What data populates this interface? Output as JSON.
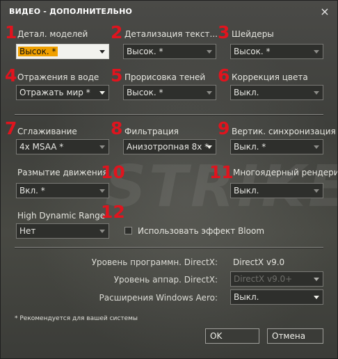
{
  "window": {
    "title": "ВИДЕО - ДОПОЛНИТЕЛЬНО"
  },
  "icons": {
    "close": "×"
  },
  "settings": [
    {
      "number": "1",
      "label": "Детал. моделей",
      "value": "Высок. *"
    },
    {
      "number": "2",
      "label": "Детализация текст...",
      "value": "Высок. *"
    },
    {
      "number": "3",
      "label": "Шейдеры",
      "value": "Высок. *"
    },
    {
      "number": "4",
      "label": "Отражения в воде",
      "value": "Отражать мир *"
    },
    {
      "number": "5",
      "label": "Прорисовка теней",
      "value": "Высок. *"
    },
    {
      "number": "6",
      "label": "Коррекция цвета",
      "value": "Выкл."
    },
    {
      "number": "7",
      "label": "Сглаживание",
      "value": "4x MSAA *"
    },
    {
      "number": "8",
      "label": "Фильтрация",
      "value": "Анизотропная 8x *"
    },
    {
      "number": "9",
      "label": "Вертик. синхронизация",
      "value": "Выкл. *"
    },
    {
      "number": "10",
      "label": "Размытие движения",
      "value": "Вкл. *"
    },
    {
      "number": "11",
      "label": "Многоядерный рендеринг",
      "value": "Выкл."
    },
    {
      "number": "12",
      "label": "High Dynamic Range",
      "value": "Нет"
    }
  ],
  "bloom": {
    "label": "Использовать эффект Bloom",
    "checked": false
  },
  "directx": {
    "software_label": "Уровень программн. DirectX:",
    "software_value": "DirectX v9.0",
    "hardware_label": "Уровень аппар. DirectX:",
    "hardware_value": "DirectX v9.0+",
    "aero_label": "Расширения Windows Aero:",
    "aero_value": "Выкл."
  },
  "note": "* Рекомендуется для вашей системы",
  "buttons": {
    "ok": "OK",
    "cancel": "Отмена"
  },
  "watermark": "STRIKE"
}
